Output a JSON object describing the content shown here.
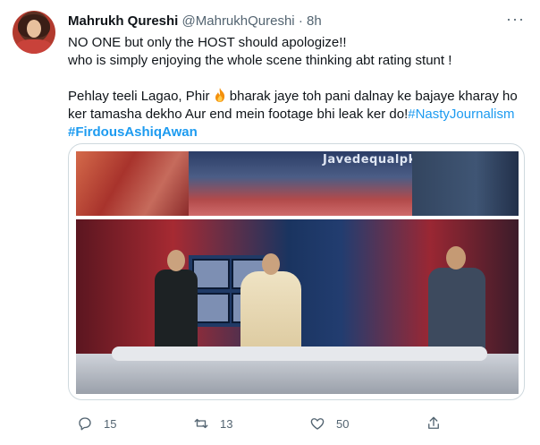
{
  "tweet": {
    "author_name": "Mahrukh Qureshi",
    "handle": "@MahrukhQureshi",
    "separator": "·",
    "time": "8h",
    "more_label": "···",
    "text": {
      "line1": "NO ONE but only the HOST should apologize!!",
      "line2": "who is simply enjoying the whole scene thinking abt rating stunt !",
      "line3_before": "Pehlay teeli Lagao, Phir",
      "line3_after": "bharak jaye toh pani dalnay ke bajaye kharay ho",
      "line4_before": "ker tamasha dekho Aur end mein footage bhi leak ker do!",
      "hashtag1": "#NastyJournalism",
      "hashtag2": "#FirdousAshiqAwan"
    },
    "media_watermark": "Javedequalpk",
    "actions": {
      "reply_count": "15",
      "retweet_count": "13",
      "like_count": "50"
    }
  },
  "icons": {
    "reply": "reply-icon",
    "retweet": "retweet-icon",
    "like": "heart-icon",
    "share": "share-icon",
    "fire": "fire-emoji-icon",
    "more": "more-options-icon"
  },
  "colors": {
    "link": "#1d9bf0",
    "muted": "#536471",
    "text": "#0f1419"
  }
}
